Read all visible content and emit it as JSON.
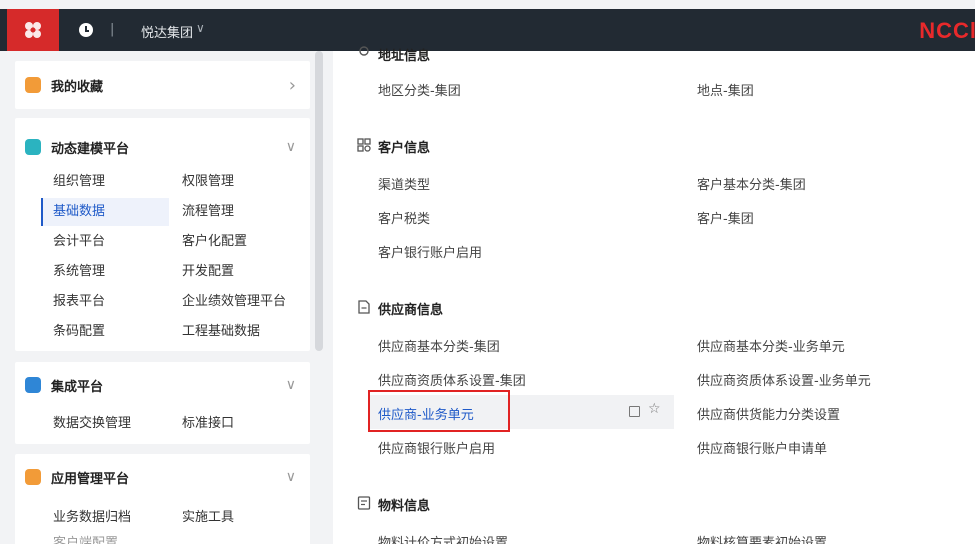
{
  "topbar": {
    "org": "悦达集团",
    "org_caret": "∨",
    "separator": "|",
    "brand": "NCCl"
  },
  "sidebar": {
    "favorites": {
      "title": "我的收藏",
      "caret": "›"
    },
    "modeling": {
      "title": "动态建模平台",
      "caret": "∨",
      "items": [
        "组织管理",
        "权限管理",
        "基础数据",
        "流程管理",
        "会计平台",
        "客户化配置",
        "系统管理",
        "开发配置",
        "报表平台",
        "企业绩效管理平台",
        "条码配置",
        "工程基础数据"
      ]
    },
    "integration": {
      "title": "集成平台",
      "caret": "∨",
      "items": [
        "数据交换管理",
        "标准接口"
      ]
    },
    "app_mgmt": {
      "title": "应用管理平台",
      "caret": "∨",
      "items": [
        "业务数据归档",
        "实施工具",
        "客户端配置"
      ]
    }
  },
  "main": {
    "region": {
      "title": "地址信息",
      "links": [
        "地区分类-集团",
        "地点-集团"
      ]
    },
    "customer": {
      "title": "客户信息",
      "links": [
        "渠道类型",
        "客户基本分类-集团",
        "客户税类",
        "客户-集团",
        "客户银行账户启用"
      ]
    },
    "supplier": {
      "title": "供应商信息",
      "links": [
        "供应商基本分类-集团",
        "供应商基本分类-业务单元",
        "供应商资质体系设置-集团",
        "供应商资质体系设置-业务单元",
        "供应商-业务单元",
        "供应商供货能力分类设置",
        "供应商银行账户启用",
        "供应商银行账户申请单"
      ]
    },
    "material": {
      "title": "物料信息",
      "links": [
        "物料计价方式初始设置",
        "物料核算要素初始设置"
      ]
    }
  },
  "colors": {
    "accent": "#1f5ac8",
    "topbar": "#222a33",
    "logo_bg": "#d62a2a",
    "highlight_border": "#e12323"
  }
}
